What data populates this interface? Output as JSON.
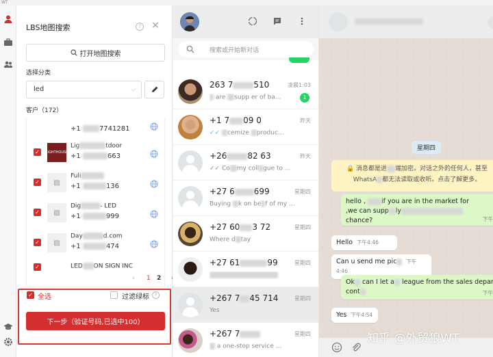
{
  "window": {
    "title": "WT"
  },
  "lbs": {
    "title": "LBS地图搜索",
    "help": "?",
    "close": "×",
    "open_map_label": "打开地图搜索",
    "category_label": "选择分类",
    "category_value": "led",
    "customers_label": "客户（172）",
    "customers": [
      {
        "name": "",
        "phone_a": "+1",
        "phone_b": "7741281",
        "logo": ""
      },
      {
        "name_a": "Lig",
        "name_b": "tdoor",
        "phone_a": "+1",
        "phone_b": "663",
        "logo": "LIGHTHOUSE"
      },
      {
        "name_a": "Fuli",
        "name_b": "",
        "phone_a": "+1",
        "phone_b": "136",
        "logo": ""
      },
      {
        "name_a": "Dig",
        "name_b": "- LED",
        "phone_a": "+1",
        "phone_b": "999",
        "logo": ""
      },
      {
        "name_a": "Day",
        "name_b": "d.com",
        "phone_a": "+1",
        "phone_b": "474",
        "logo": ""
      },
      {
        "name_a": "LED",
        "name_b": "ON SIGN INC",
        "phone_a": "",
        "phone_b": "",
        "logo": ""
      }
    ],
    "pager": {
      "prev": "‹",
      "page1": "1",
      "page2": "2",
      "next": "›"
    },
    "select_all_label": "全选",
    "filter_label": "过滤绿标",
    "filter_help": "?",
    "next_button": "下一步（验证号码,已选中100）"
  },
  "chats": {
    "search_placeholder": "搜索或开始新对话",
    "items": [
      {
        "name": "263 7",
        "name_tail": "510",
        "preview_a": "are ",
        "preview_b": "supp",
        "preview_c": "er of ba...",
        "time": "凌晨1:03",
        "badge": "1",
        "avatar": "photo1"
      },
      {
        "name": "+1 7",
        "name_tail": "09 0",
        "preview_a": "✓✓ ",
        "preview_b": "cemize ",
        "preview_c": "produc...",
        "time": "昨天",
        "badge": "",
        "avatar": "photo2"
      },
      {
        "name": "+26",
        "name_tail": "82 63",
        "preview_a": "✓✓ Co",
        "preview_b": "my coll",
        "preview_c": "gue to ...",
        "time": "昨天",
        "badge": "",
        "avatar": "default"
      },
      {
        "name": "+27 6",
        "name_tail": "699",
        "preview_a": "Buying ",
        "preview_b": "k on be",
        "preview_c": "f of my ...",
        "time": "星期四",
        "badge": "",
        "avatar": "default"
      },
      {
        "name": "+27 60",
        "name_tail": "3 72",
        "preview_a": "Where d",
        "preview_b": "",
        "preview_c": "tay",
        "time": "星期四",
        "badge": "",
        "avatar": "photo3"
      },
      {
        "name": "+27 61",
        "name_tail": "99",
        "preview_a": "",
        "preview_b": "",
        "preview_c": "",
        "time": "星期四",
        "badge": "",
        "avatar": "photo4"
      },
      {
        "name": "+267 7",
        "name_tail": "45 714",
        "preview_a": "Yes",
        "preview_b": "",
        "preview_c": "",
        "time": "星期四",
        "badge": "",
        "avatar": "default"
      },
      {
        "name": "+267 7",
        "name_tail": "",
        "preview_a": "",
        "preview_b": "a one-stop service ...",
        "preview_c": "",
        "time": "星期四",
        "badge": "",
        "avatar": "photo5"
      }
    ]
  },
  "conversation": {
    "date_chip": "星期四",
    "encryption_notice_a": "消息都是进",
    "encryption_notice_b": "端加密。对话之外的任何人，甚至",
    "encryption_notice_c": "WhatsA",
    "encryption_notice_d": "都无法读取或收听。点击了解更多。",
    "messages": [
      {
        "dir": "out",
        "text": "hello , ",
        "text_b": "if you are in the market for",
        "text_c": ",we can supp",
        "text_d": "ly",
        "text_e": " chance?",
        "time": "下午"
      },
      {
        "dir": "in",
        "text": "Hello",
        "time": "下午4:46"
      },
      {
        "dir": "in",
        "text": "Can u send me pic",
        "time": "下午4:46"
      },
      {
        "dir": "out",
        "text": "Ok",
        "text_b": " can I let a",
        "text_c": " league from the sales depart",
        "text_d": "cont",
        "time": "下午"
      },
      {
        "dir": "in",
        "text": "Yes",
        "time": "下午4:54"
      }
    ],
    "watermark": "知乎 @外贸狼WT"
  },
  "colors": {
    "accent": "#d32f2f",
    "whatsapp_green": "#25d366",
    "out_bubble": "#dcf8c6"
  }
}
